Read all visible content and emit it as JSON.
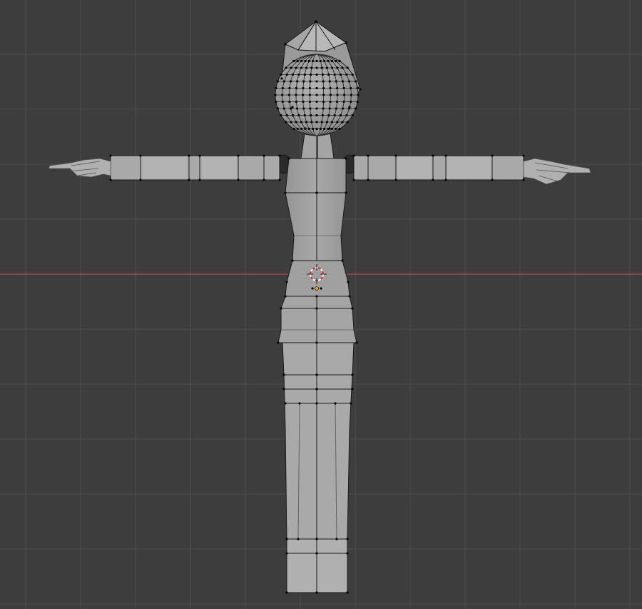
{
  "viewport": {
    "mode": "edit-mode-wireframe",
    "view": "front-orthographic",
    "colors": {
      "background": "#3d3d3d",
      "grid_major": "#4d4d4d",
      "grid_minor": "#454545",
      "x_axis": "#b04c56",
      "mesh_fill": "#9d9d9d",
      "mesh_fill_light": "#ababab",
      "mesh_edge": "#1a1a1a",
      "vertex": "#000000",
      "cursor_ring_a": "#d6332e",
      "cursor_ring_b": "#ffffff"
    },
    "icons": {
      "cursor": "3d-cursor-icon",
      "origin": "object-origin-icon"
    },
    "objects": [
      {
        "name": "head-sphere"
      },
      {
        "name": "hair-mesh"
      },
      {
        "name": "neck"
      },
      {
        "name": "torso"
      },
      {
        "name": "arm-left"
      },
      {
        "name": "arm-right"
      },
      {
        "name": "hand-left"
      },
      {
        "name": "hand-right"
      },
      {
        "name": "hips"
      },
      {
        "name": "leg-left"
      },
      {
        "name": "leg-right"
      }
    ]
  }
}
